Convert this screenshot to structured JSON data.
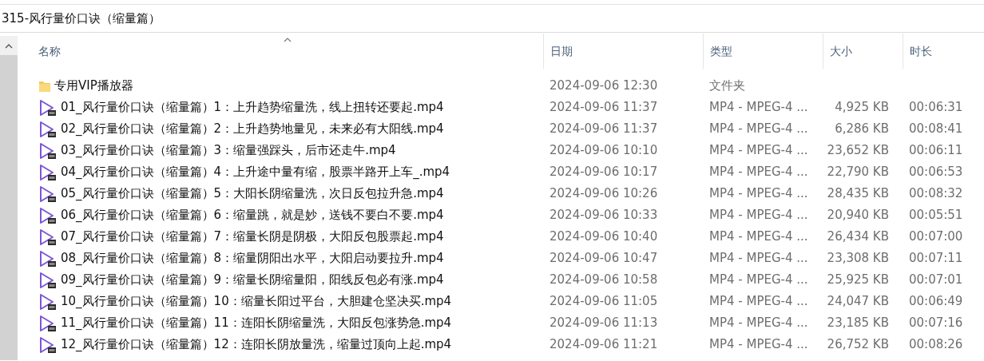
{
  "address_bar": {
    "path": "315-风行量价口诀（缩量篇）"
  },
  "table": {
    "columns": [
      {
        "label": "名称",
        "sorted": true
      },
      {
        "label": "日期",
        "sorted": false
      },
      {
        "label": "类型",
        "sorted": false
      },
      {
        "label": "大小",
        "sorted": false
      },
      {
        "label": "时长",
        "sorted": false
      }
    ],
    "rows": [
      {
        "kind": "folder",
        "name": "专用VIP播放器",
        "date": "2024-09-06 12:30",
        "type": "文件夹"
      },
      {
        "kind": "video",
        "name": "01_风行量价口诀（缩量篇）1：上升趋势缩量洗，线上扭转还要起.mp4",
        "date": "2024-09-06 11:37",
        "type": "MP4 - MPEG-4 ...",
        "size": "4,925 KB",
        "duration": "00:06:31"
      },
      {
        "kind": "video",
        "name": "02_风行量价口诀（缩量篇）2：上升趋势地量见，未来必有大阳线.mp4",
        "date": "2024-09-06 11:37",
        "type": "MP4 - MPEG-4 ...",
        "size": "6,286 KB",
        "duration": "00:08:41"
      },
      {
        "kind": "video",
        "name": "03_风行量价口诀（缩量篇）3：缩量强踩头，后市还走牛.mp4",
        "date": "2024-09-06 10:10",
        "type": "MP4 - MPEG-4 ...",
        "size": "23,652 KB",
        "duration": "00:06:11"
      },
      {
        "kind": "video",
        "name": "04_风行量价口诀（缩量篇）4：上升途中量有缩，股票半路开上车_.mp4",
        "date": "2024-09-06 10:17",
        "type": "MP4 - MPEG-4 ...",
        "size": "22,790 KB",
        "duration": "00:06:53"
      },
      {
        "kind": "video",
        "name": "05_风行量价口诀（缩量篇）5：大阳长阴缩量洗，次日反包拉升急.mp4",
        "date": "2024-09-06 10:26",
        "type": "MP4 - MPEG-4 ...",
        "size": "28,435 KB",
        "duration": "00:08:32"
      },
      {
        "kind": "video",
        "name": "06_风行量价口诀（缩量篇）6：缩量跳，就是妙，送钱不要白不要.mp4",
        "date": "2024-09-06 10:33",
        "type": "MP4 - MPEG-4 ...",
        "size": "20,940 KB",
        "duration": "00:05:51"
      },
      {
        "kind": "video",
        "name": "07_风行量价口诀（缩量篇）7：缩量长阴是阴极，大阳反包股票起.mp4",
        "date": "2024-09-06 10:40",
        "type": "MP4 - MPEG-4 ...",
        "size": "26,434 KB",
        "duration": "00:07:00"
      },
      {
        "kind": "video",
        "name": "08_风行量价口诀（缩量篇）8：缩量阴阳出水平，大阳启动要拉升.mp4",
        "date": "2024-09-06 10:47",
        "type": "MP4 - MPEG-4 ...",
        "size": "23,308 KB",
        "duration": "00:07:11"
      },
      {
        "kind": "video",
        "name": "09_风行量价口诀（缩量篇）9：缩量长阴缩量阳，阳线反包必有涨.mp4",
        "date": "2024-09-06 10:58",
        "type": "MP4 - MPEG-4 ...",
        "size": "25,925 KB",
        "duration": "00:07:01"
      },
      {
        "kind": "video",
        "name": "10_风行量价口诀（缩量篇）10：缩量长阳过平台，大胆建仓坚决买.mp4",
        "date": "2024-09-06 11:05",
        "type": "MP4 - MPEG-4 ...",
        "size": "24,047 KB",
        "duration": "00:06:49"
      },
      {
        "kind": "video",
        "name": "11_风行量价口诀（缩量篇）11：连阳长阴缩量洗，大阳反包涨势急.mp4",
        "date": "2024-09-06 11:13",
        "type": "MP4 - MPEG-4 ...",
        "size": "23,185 KB",
        "duration": "00:07:16"
      },
      {
        "kind": "video",
        "name": "12_风行量价口诀（缩量篇）12：连阳长阴放量洗，缩量过顶向上起.mp4",
        "date": "2024-09-06 11:21",
        "type": "MP4 - MPEG-4 ...",
        "size": "26,752 KB",
        "duration": "00:08:26"
      }
    ]
  }
}
